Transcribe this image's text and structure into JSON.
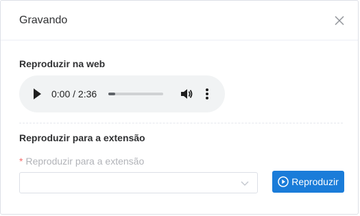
{
  "dialog": {
    "title": "Gravando",
    "close_icon": "close-icon"
  },
  "web_section": {
    "title": "Reproduzir na web",
    "player": {
      "time": "0:00 / 2:36",
      "progress": 0.12,
      "icons": [
        "play-icon",
        "volume-icon",
        "more-vertical-icon"
      ]
    }
  },
  "extension_section": {
    "title": "Reproduzir para a extensão",
    "field_label": "Reproduzir para a extensão",
    "required_mark": "*",
    "select_value": "",
    "button_label": "Reproduzir",
    "button_icon": "play-circle-icon",
    "accent_color": "#1a7cd9"
  }
}
